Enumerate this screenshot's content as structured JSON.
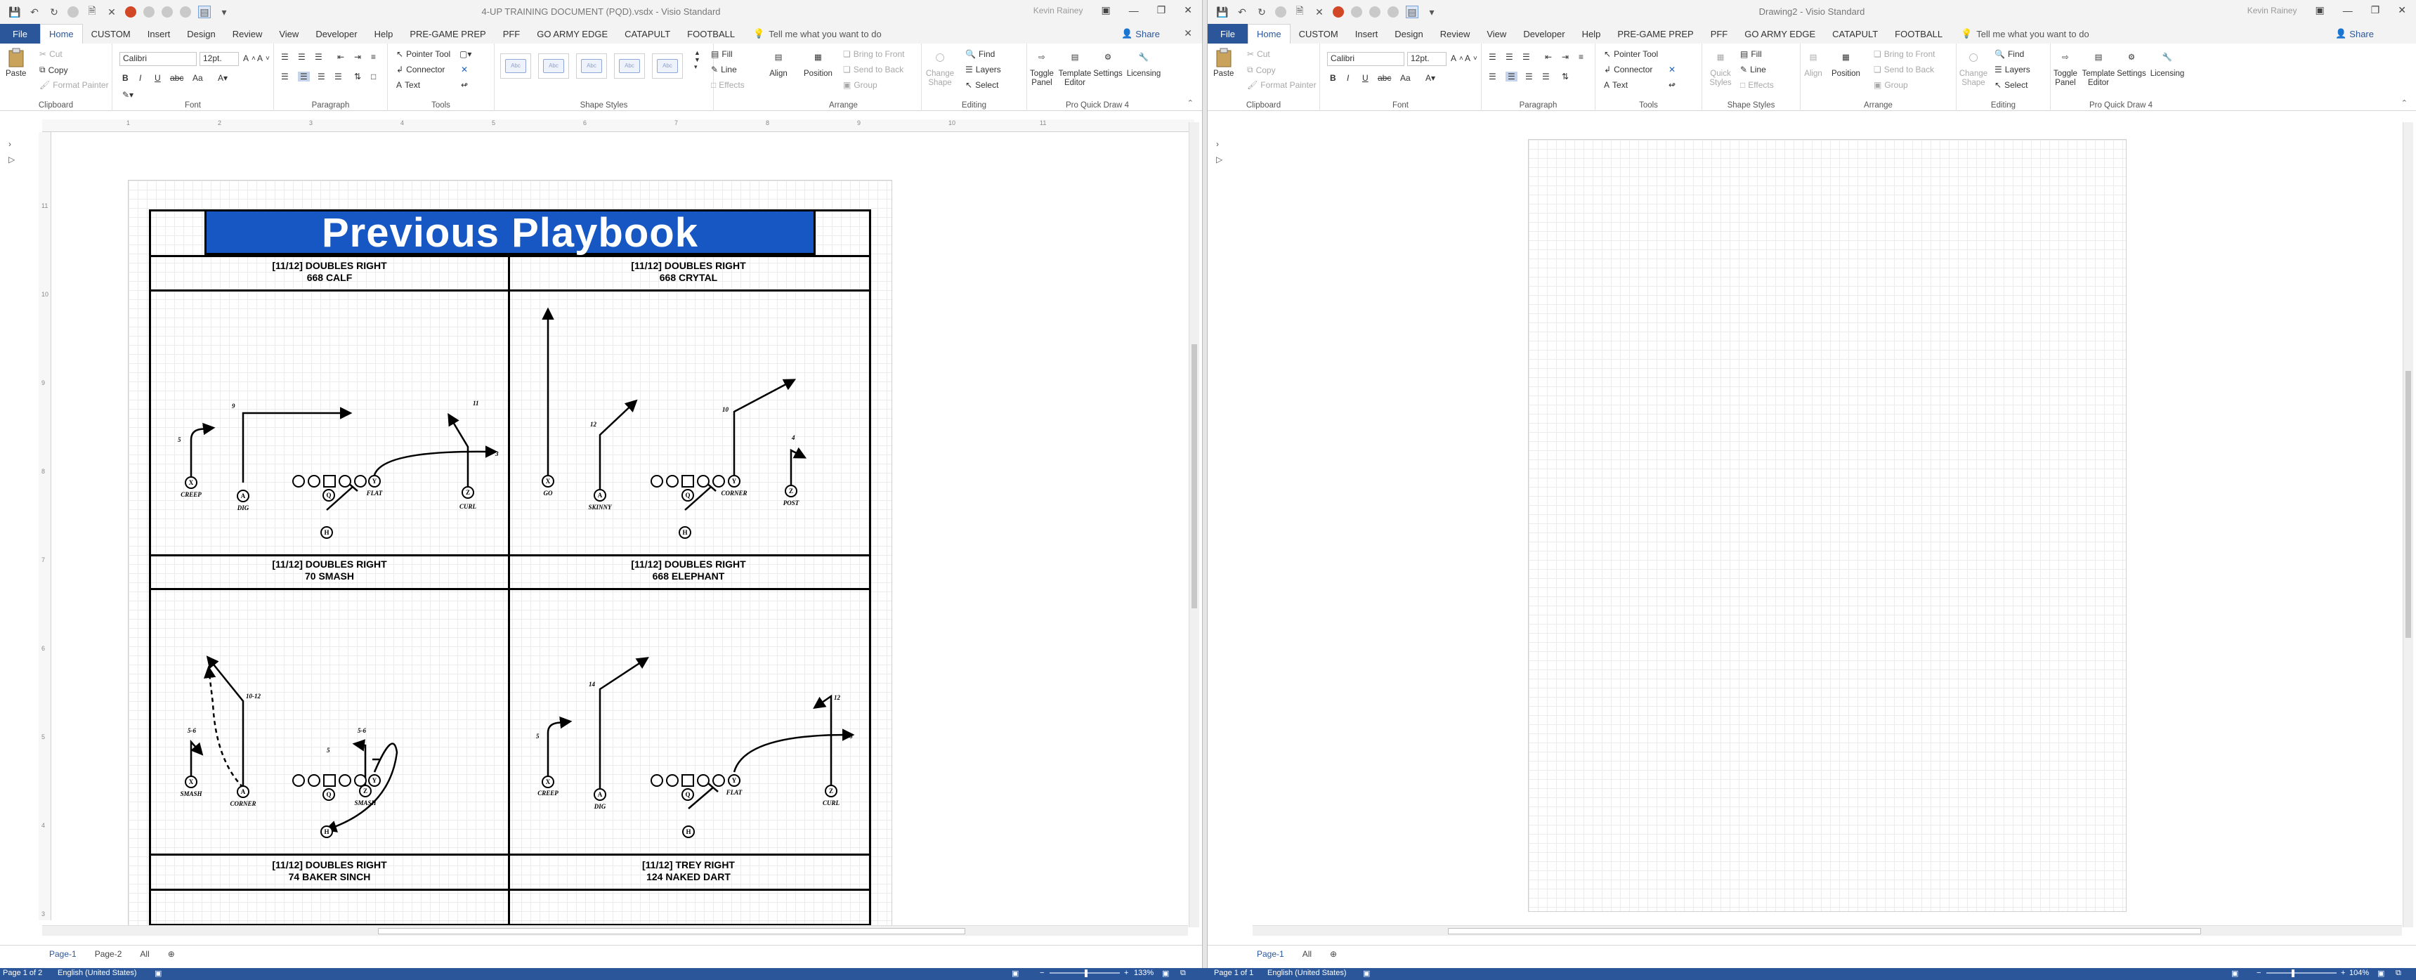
{
  "left_window": {
    "title": "4-UP TRAINING DOCUMENT (PQD).vsdx  -  Visio Standard",
    "account": "Kevin Rainey",
    "tabs": [
      "File",
      "Home",
      "CUSTOM",
      "Insert",
      "Design",
      "Review",
      "View",
      "Developer",
      "Help",
      "PRE-GAME PREP",
      "PFF",
      "GO ARMY EDGE",
      "CATAPULT",
      "FOOTBALL"
    ],
    "tell_me": "Tell me what you want to do",
    "share": "Share",
    "ribbon": {
      "clipboard": {
        "paste": "Paste",
        "cut": "Cut",
        "copy": "Copy",
        "format_painter": "Format Painter",
        "label": "Clipboard"
      },
      "font": {
        "name": "Calibri",
        "size": "12pt.",
        "bold": "B",
        "italic": "I",
        "underline": "U",
        "label": "Font"
      },
      "paragraph": {
        "label": "Paragraph"
      },
      "tools": {
        "pointer": "Pointer Tool",
        "connector": "Connector",
        "text": "Text",
        "label": "Tools"
      },
      "shape_styles": {
        "swatch": "Abc",
        "label": "Shape Styles"
      },
      "fill": "Fill",
      "line": "Line",
      "effects": "Effects",
      "arrange": {
        "align": "Align",
        "position": "Position",
        "bring_to_front": "Bring to Front",
        "send_to_back": "Send to Back",
        "group": "Group",
        "label": "Arrange"
      },
      "editing": {
        "change_shape": "Change Shape",
        "find": "Find",
        "layers": "Layers",
        "select": "Select",
        "label": "Editing"
      },
      "pro": {
        "toggle_panel": "Toggle Panel",
        "template_editor": "Template Editor",
        "settings": "Settings",
        "licensing": "Licensing",
        "label": "Pro Quick Draw 4"
      }
    },
    "page_tabs": [
      "Page-1",
      "Page-2",
      "All"
    ],
    "ruler_h": [
      "1",
      "2",
      "3",
      "4",
      "5",
      "6",
      "7",
      "8",
      "9",
      "10",
      "11"
    ],
    "ruler_v": [
      "11",
      "10",
      "9",
      "8",
      "7",
      "6",
      "5",
      "4",
      "3"
    ]
  },
  "right_window": {
    "title": "Drawing2  -  Visio Standard",
    "account": "Kevin Rainey",
    "tabs": [
      "File",
      "Home",
      "CUSTOM",
      "Insert",
      "Design",
      "Review",
      "View",
      "Developer",
      "Help",
      "PRE-GAME PREP",
      "PFF",
      "GO ARMY EDGE",
      "CATAPULT",
      "FOOTBALL"
    ],
    "tell_me": "Tell me what you want to do",
    "share": "Share",
    "ribbon": {
      "quick_styles": "Quick Styles",
      "align": "Align",
      "position": "Position",
      "change_shape": "Change Shape"
    },
    "page_tabs": [
      "Page-1",
      "All"
    ]
  },
  "playbook": {
    "title": "Previous Playbook",
    "plays": [
      {
        "formation": "[11/12] DOUBLES RIGHT",
        "name": "668 CALF",
        "labels": {
          "x_route": "CREEP",
          "a_route": "DIG",
          "y_route": "FLAT",
          "z_route": "CURL",
          "depth_x": "5",
          "depth_a": "9",
          "depth_z": "11",
          "depth_y": "3"
        }
      },
      {
        "formation": "[11/12] DOUBLES RIGHT",
        "name": "668 CRYTAL",
        "labels": {
          "x_route": "GO",
          "a_route": "SKINNY",
          "y_route": "CORNER",
          "z_route": "POST",
          "depth_a": "12",
          "depth_y": "10",
          "depth_z": "4"
        }
      },
      {
        "formation": "[11/12] DOUBLES RIGHT",
        "name": "70 SMASH",
        "labels": {
          "x_route": "SMASH",
          "a_route": "CORNER",
          "z_route": "SMASH",
          "depth_x": "5-6",
          "depth_a": "10-12",
          "depth_z": "5-6",
          "depth_y": "5"
        }
      },
      {
        "formation": "[11/12] DOUBLES RIGHT",
        "name": "668 ELEPHANT",
        "labels": {
          "x_route": "CREEP",
          "a_route": "DIG",
          "y_route": "FLAT",
          "z_route": "CURL",
          "depth_x": "5",
          "depth_a": "14",
          "depth_z": "12",
          "depth_y": "6"
        }
      },
      {
        "formation": "[11/12] DOUBLES RIGHT",
        "name": "74 BAKER SINCH"
      },
      {
        "formation": "[11/12] TREY RIGHT",
        "name": "124 NAKED DART"
      }
    ],
    "player_letters": {
      "x": "X",
      "a": "A",
      "q": "Q",
      "y": "Y",
      "z": "Z",
      "h": "H"
    }
  },
  "status_left": {
    "page": "Page 1 of 2",
    "language": "English (United States)",
    "zoom": "133%"
  },
  "status_right": {
    "page": "Page 1 of 1",
    "language": "English (United States)",
    "zoom": "104%"
  },
  "colors": {
    "file_tab": "#2b579a",
    "title_banner": "#1757c4",
    "status_bar": "#2b579a"
  }
}
